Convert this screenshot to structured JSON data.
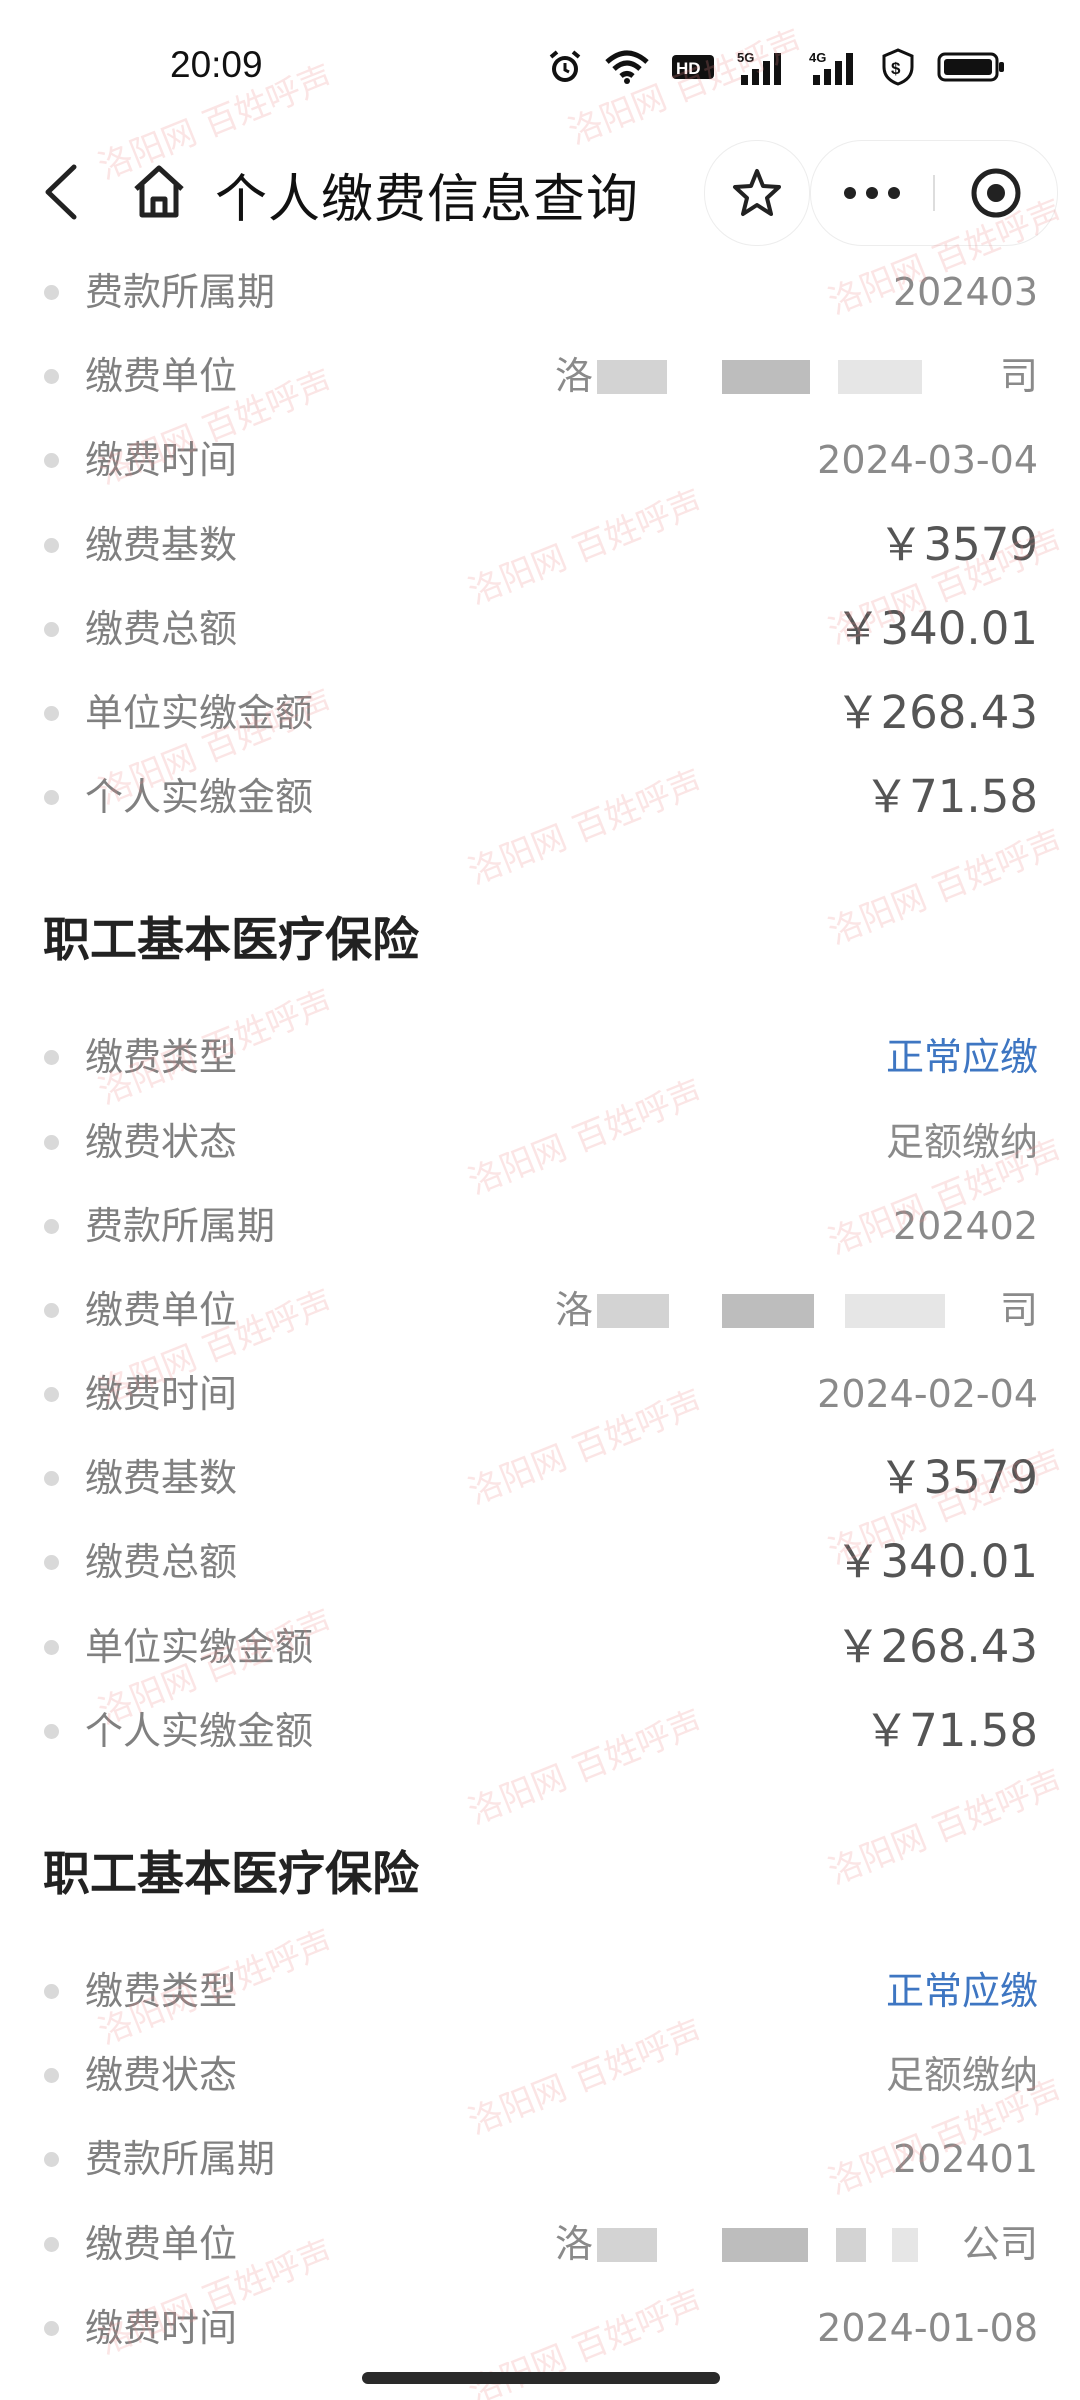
{
  "status_bar": {
    "time": "20:09",
    "icons": [
      "alarm-icon",
      "wifi-icon",
      "hd-icon",
      "signal-5g-icon",
      "signal-4g-icon",
      "shield-dollar-icon",
      "battery-icon"
    ]
  },
  "nav": {
    "title": "个人缴费信息查询",
    "icons": [
      "back-icon",
      "home-icon",
      "star-icon",
      "more-icon",
      "close-target-icon"
    ]
  },
  "top_partial_record": {
    "rows": [
      {
        "label": "费款所属期",
        "value": "202403"
      },
      {
        "label": "缴费单位",
        "value": "洛",
        "value_end": "司"
      },
      {
        "label": "缴费时间",
        "value": "2024-03-04"
      },
      {
        "label": "缴费基数",
        "value": "￥3579"
      },
      {
        "label": "缴费总额",
        "value": "￥340.01"
      },
      {
        "label": "单位实缴金额",
        "value": "￥268.43"
      },
      {
        "label": "个人实缴金额",
        "value": "￥71.58"
      }
    ]
  },
  "sections": [
    {
      "title": "职工基本医疗保险",
      "rows": [
        {
          "label": "缴费类型",
          "value": "正常应缴"
        },
        {
          "label": "缴费状态",
          "value": "足额缴纳"
        },
        {
          "label": "费款所属期",
          "value": "202402"
        },
        {
          "label": "缴费单位",
          "value": "洛",
          "value_end": "司"
        },
        {
          "label": "缴费时间",
          "value": "2024-02-04"
        },
        {
          "label": "缴费基数",
          "value": "￥3579"
        },
        {
          "label": "缴费总额",
          "value": "￥340.01"
        },
        {
          "label": "单位实缴金额",
          "value": "￥268.43"
        },
        {
          "label": "个人实缴金额",
          "value": "￥71.58"
        }
      ]
    },
    {
      "title": "职工基本医疗保险",
      "rows": [
        {
          "label": "缴费类型",
          "value": "正常应缴"
        },
        {
          "label": "缴费状态",
          "value": "足额缴纳"
        },
        {
          "label": "费款所属期",
          "value": "202401"
        },
        {
          "label": "缴费单位",
          "value": "洛",
          "value_end": "公司"
        },
        {
          "label": "缴费时间",
          "value": "2024-01-08"
        }
      ]
    }
  ],
  "colors": {
    "accent_blue": "#3e76c2",
    "label_gray": "#808080",
    "bullet_gray": "#d9d9d9",
    "watermark": "#eb8787"
  },
  "watermark_text": "洛阳网 百姓呼声"
}
